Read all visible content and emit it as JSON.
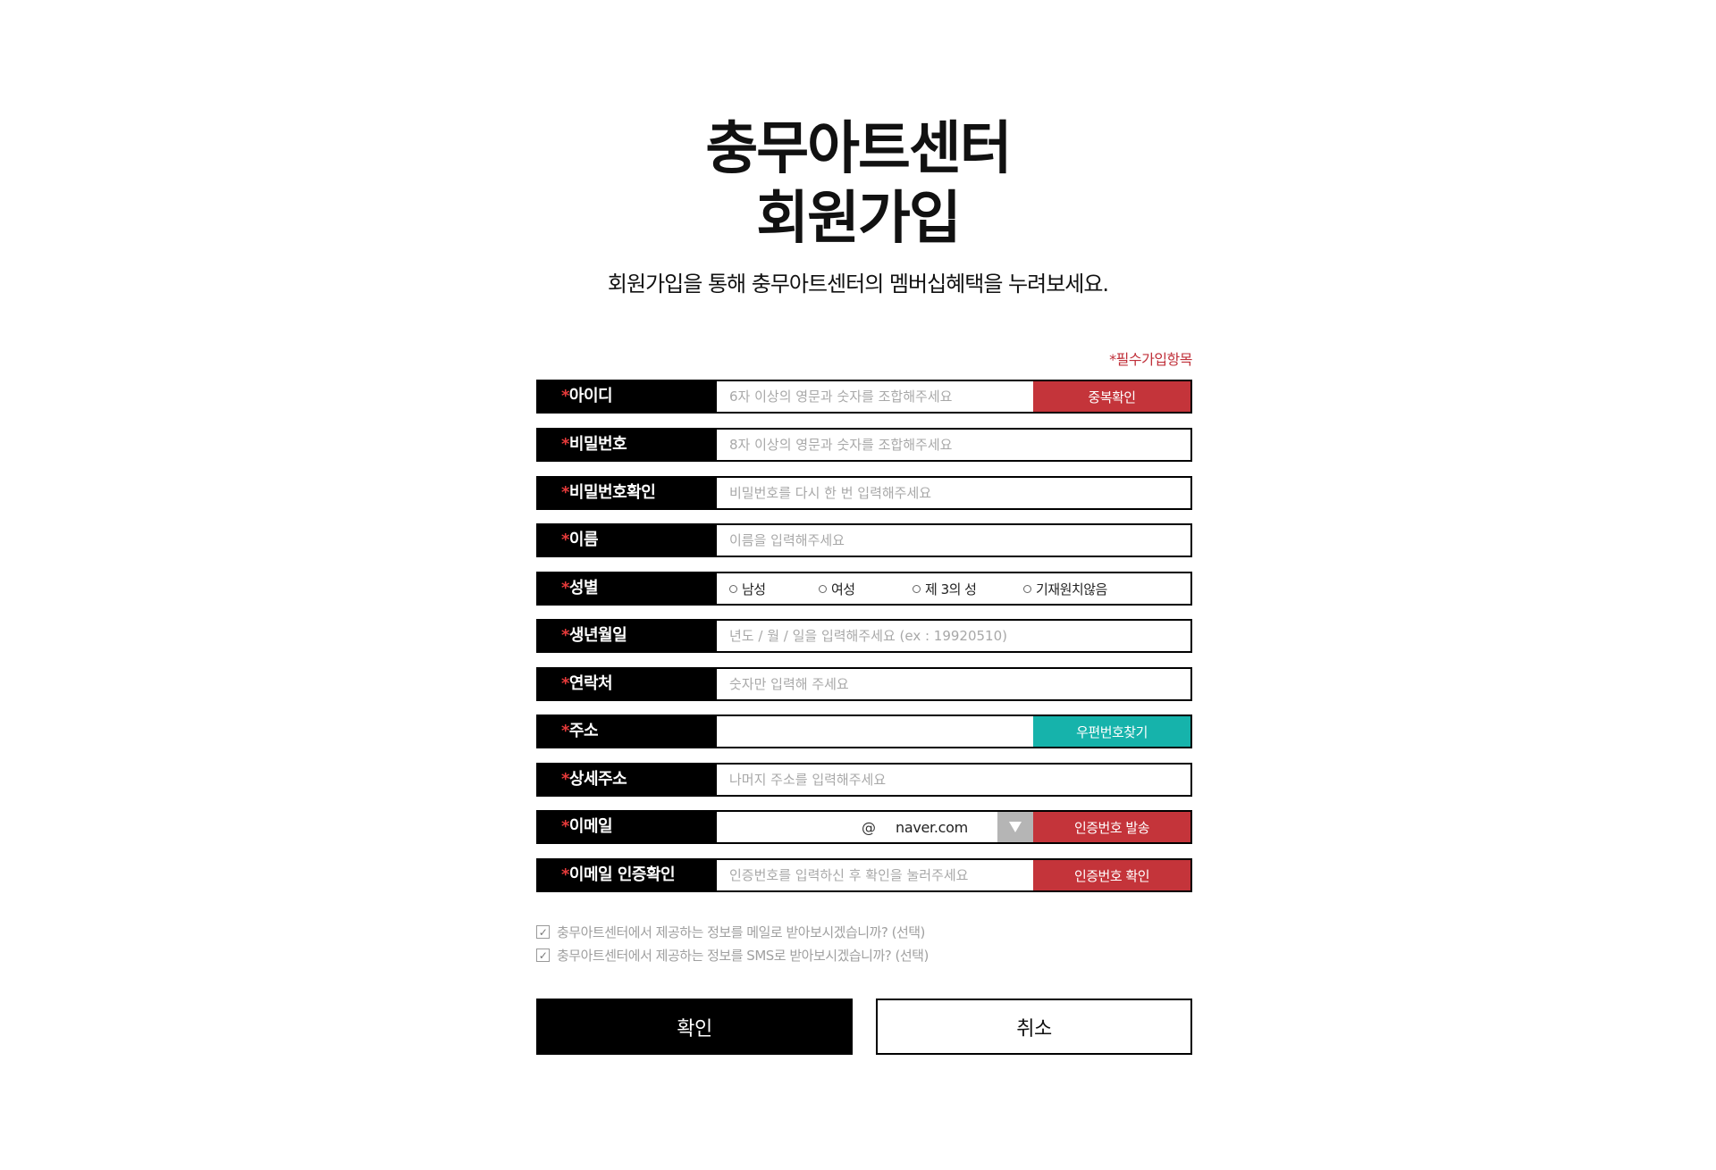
{
  "header": {
    "title_line1": "충무아트센터",
    "title_line2": "회원가입",
    "subtitle": "회원가입을 통해 충무아트센터의 멤버십혜택을 누려보세요."
  },
  "required_note": "*필수가입항목",
  "fields": {
    "userid": {
      "label": "아이디",
      "placeholder": "6자 이상의 영문과 숫자를 조합해주세요",
      "button": "중복확인"
    },
    "password": {
      "label": "비밀번호",
      "placeholder": "8자 이상의 영문과 숫자를 조합해주세요"
    },
    "password_confirm": {
      "label": "비밀번호확인",
      "placeholder": "비밀번호를 다시 한 번 입력해주세요"
    },
    "name": {
      "label": "이름",
      "placeholder": "이름을 입력해주세요"
    },
    "gender": {
      "label": "성별",
      "options": [
        "남성",
        "여성",
        "제 3의 성",
        "기재원치않음"
      ]
    },
    "birthdate": {
      "label": "생년월일",
      "placeholder": "년도 / 월 / 일을 입력해주세요 (ex : 19920510)"
    },
    "phone": {
      "label": "연락처",
      "placeholder": "숫자만 입력해 주세요"
    },
    "address": {
      "label": "주소",
      "placeholder": "",
      "button": "우편번호찾기"
    },
    "address_detail": {
      "label": "상세주소",
      "placeholder": "나머지 주소를 입력해주세요"
    },
    "email": {
      "label": "이메일",
      "at": "@",
      "domain": "naver.com",
      "button": "인증번호 발송"
    },
    "email_verify": {
      "label": "이메일 인증확인",
      "placeholder": "인증번호를 입력하신 후 확인을 눌러주세요",
      "button": "인증번호 확인"
    }
  },
  "required_mark": "*",
  "agreements": [
    "충무아트센터에서 제공하는 정보를 메일로 받아보시겠습니까? (선택)",
    "충무아트센터에서 제공하는 정보를 SMS로 받아보시겠습니까? (선택)"
  ],
  "actions": {
    "confirm": "확인",
    "cancel": "취소"
  },
  "colors": {
    "red": "#c4343a",
    "teal": "#16b3ab",
    "black": "#000000",
    "required_note": "#c0303a"
  },
  "icons": {
    "check": "check-icon",
    "radio": "radio-icon",
    "dropdown": "dropdown-triangle-icon"
  }
}
